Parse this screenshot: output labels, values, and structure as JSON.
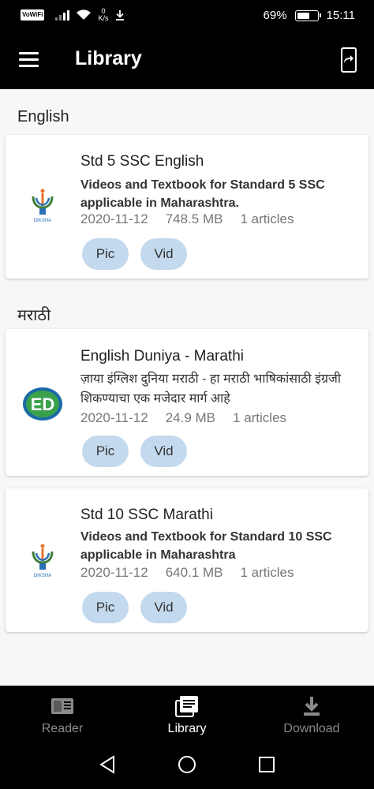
{
  "status_bar": {
    "volte": "VoWiFi",
    "speed_value": "0",
    "speed_unit": "K/s",
    "battery_percent": "69%",
    "battery_level": 0.69,
    "time": "15:11"
  },
  "app_bar": {
    "title": "Library"
  },
  "sections": [
    {
      "title": "English",
      "cards": [
        {
          "title": "Std 5 SSC English",
          "description": "Videos and Textbook for Standard 5 SSC applicable in Maharashtra.",
          "date": "2020-11-12",
          "size": "748.5 MB",
          "articles": "1 articles",
          "tags": [
            "Pic",
            "Vid"
          ],
          "logo": "diksha-logo",
          "logo_text": "DIKSHA"
        }
      ]
    },
    {
      "title": "मराठी",
      "cards": [
        {
          "title": "English Duniya - Marathi",
          "description": "ज़ाया इंग्लिश दुनिया मराठी - हा मराठी भाषिकांसाठी इंग्रजी शिकण्याचा एक मजेदार मार्ग आहे",
          "date": "2020-11-12",
          "size": "24.9 MB",
          "articles": "1 articles",
          "tags": [
            "Pic",
            "Vid"
          ],
          "logo": "ed-logo",
          "logo_text": "ED"
        },
        {
          "title": "Std 10 SSC Marathi",
          "description": "Videos and Textbook for Standard 10 SSC applicable in Maharashtra",
          "date": "2020-11-12",
          "size": "640.1 MB",
          "articles": "1 articles",
          "tags": [
            "Pic",
            "Vid"
          ],
          "logo": "diksha-logo",
          "logo_text": "DIKSHA"
        }
      ]
    }
  ],
  "bottom_nav": {
    "items": [
      {
        "label": "Reader",
        "icon": "reader-icon",
        "active": false
      },
      {
        "label": "Library",
        "icon": "library-icon",
        "active": true
      },
      {
        "label": "Download",
        "icon": "download-icon",
        "active": false
      }
    ],
    "active_color": "#ffffff",
    "inactive_color": "#8a8a8a"
  },
  "colors": {
    "bar_background": "#000000",
    "tag_background": "#c3d9ed",
    "page_background": "#f7f7f7"
  }
}
